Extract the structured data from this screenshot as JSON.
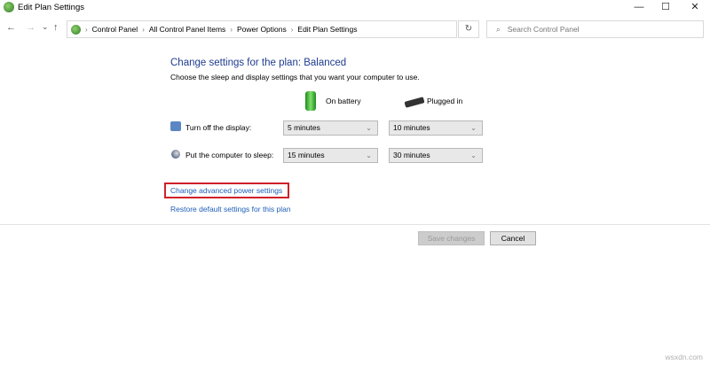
{
  "window": {
    "title": "Edit Plan Settings",
    "minimize": "—",
    "maximize": "☐",
    "close": "✕"
  },
  "nav": {
    "back": "←",
    "forward": "→",
    "recent": "⌄",
    "up": "↑",
    "refresh": "↻",
    "breadcrumb": [
      "Control Panel",
      "All Control Panel Items",
      "Power Options",
      "Edit Plan Settings"
    ],
    "separator": "›",
    "search_placeholder": "Search Control Panel",
    "search_icon": "⌕"
  },
  "main": {
    "heading": "Change settings for the plan: Balanced",
    "subtitle": "Choose the sleep and display settings that you want your computer to use.",
    "columns": {
      "battery": "On battery",
      "plugged": "Plugged in"
    },
    "rows": [
      {
        "label": "Turn off the display:",
        "battery": "5 minutes",
        "plugged": "10 minutes"
      },
      {
        "label": "Put the computer to sleep:",
        "battery": "15 minutes",
        "plugged": "30 minutes"
      }
    ],
    "advanced_link": "Change advanced power settings",
    "restore_link": "Restore default settings for this plan",
    "highlight_color": "#d0202a"
  },
  "footer": {
    "save": "Save changes",
    "cancel": "Cancel"
  },
  "watermark": "wsxdn.com"
}
